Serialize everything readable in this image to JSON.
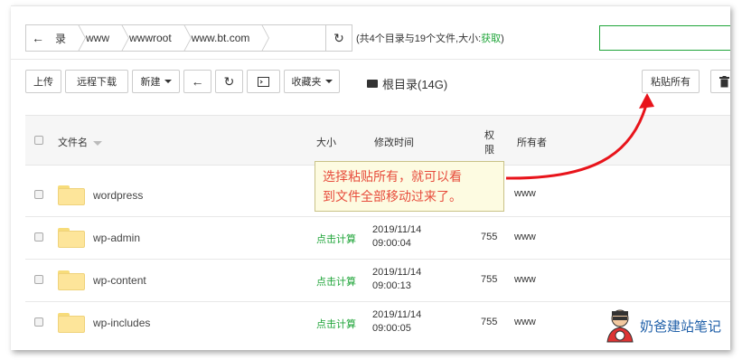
{
  "pathbar": {
    "back_icon": "arrow-left-icon",
    "crumbs": [
      "录",
      "www",
      "wwwroot",
      "www.bt.com"
    ],
    "refresh_icon": "refresh-icon"
  },
  "stats": {
    "text": "(共4个目录与19个文件,大小:",
    "link": "获取",
    "close": ")"
  },
  "toolbar": {
    "upload": "上传",
    "remote_download": "远程下载",
    "new": "新建",
    "favorites": "收藏夹",
    "root_dir": "根目录(14G)",
    "paste_all": "粘贴所有"
  },
  "table": {
    "headers": {
      "name": "文件名",
      "size": "大小",
      "mtime": "修改时间",
      "perm_1": "权",
      "perm_2": "限",
      "owner": "所有者"
    },
    "rows": [
      {
        "name": "wordpress",
        "size": "",
        "date": "",
        "time": "",
        "perm": "",
        "owner": "www"
      },
      {
        "name": "wp-admin",
        "size": "点击计算",
        "date": "2019/11/14",
        "time": "09:00:04",
        "perm": "755",
        "owner": "www"
      },
      {
        "name": "wp-content",
        "size": "点击计算",
        "date": "2019/11/14",
        "time": "09:00:13",
        "perm": "755",
        "owner": "www"
      },
      {
        "name": "wp-includes",
        "size": "点击计算",
        "date": "2019/11/14",
        "time": "09:00:05",
        "perm": "755",
        "owner": "www"
      }
    ]
  },
  "callout": {
    "line1": "选择粘贴所有，就可以看",
    "line2": "到文件全部移动过来了。"
  },
  "watermark": {
    "text": "奶爸建站笔记"
  },
  "colors": {
    "accent_green": "#20a53a",
    "annotation_red": "#e74c3c"
  }
}
